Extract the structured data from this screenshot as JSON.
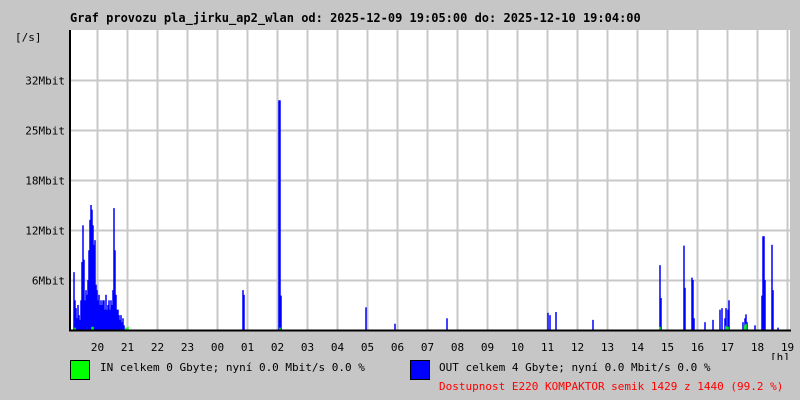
{
  "chart_data": {
    "type": "line",
    "title": "Graf provozu pla_jirku_ap2_wlan od: 2025-12-09 19:05:00 do: 2025-12-10 19:04:00",
    "ylabel": "[/s]",
    "xlabel": "[h]",
    "x_unit": "minutes since 2025-12-09 19:05",
    "xlim": [
      0,
      1440
    ],
    "ylim": [
      0,
      38.4
    ],
    "y_unit": "Mbit/s",
    "grid": true,
    "y_ticks": [
      {
        "value": 6.4,
        "label": "6Mbit"
      },
      {
        "value": 12.8,
        "label": "12Mbit"
      },
      {
        "value": 19.2,
        "label": "18Mbit"
      },
      {
        "value": 25.6,
        "label": "25Mbit"
      },
      {
        "value": 32.0,
        "label": "32Mbit"
      }
    ],
    "x_ticks": [
      "20",
      "21",
      "22",
      "23",
      "00",
      "01",
      "02",
      "03",
      "04",
      "05",
      "06",
      "07",
      "08",
      "09",
      "10",
      "11",
      "12",
      "13",
      "14",
      "15",
      "16",
      "17",
      "18",
      "19"
    ],
    "first_tick_minutes": 55,
    "series": [
      {
        "name": "IN",
        "color": "#00ff00",
        "points": [
          [
            10,
            0.3
          ],
          [
            44,
            0.4
          ],
          [
            46,
            0.4
          ],
          [
            112,
            0.3
          ],
          [
            116,
            0.4
          ],
          [
            420,
            0.3
          ],
          [
            1180,
            0.4
          ],
          [
            1312,
            0.5
          ],
          [
            1316,
            0.4
          ],
          [
            1350,
            0.6
          ],
          [
            1352,
            0.8
          ]
        ]
      },
      {
        "name": "OUT",
        "color": "#0000ff",
        "points": [
          [
            8,
            7.4
          ],
          [
            10,
            3.8
          ],
          [
            12,
            2.8
          ],
          [
            14,
            1.5
          ],
          [
            16,
            3.2
          ],
          [
            18,
            1.9
          ],
          [
            20,
            1.3
          ],
          [
            22,
            3.8
          ],
          [
            24,
            8.7
          ],
          [
            26,
            13.4
          ],
          [
            28,
            9.0
          ],
          [
            30,
            3.8
          ],
          [
            32,
            5.1
          ],
          [
            34,
            4.5
          ],
          [
            36,
            6.4
          ],
          [
            38,
            10.2
          ],
          [
            40,
            14.1
          ],
          [
            42,
            16.0
          ],
          [
            44,
            15.4
          ],
          [
            46,
            13.4
          ],
          [
            48,
            10.9
          ],
          [
            50,
            11.5
          ],
          [
            52,
            5.8
          ],
          [
            54,
            5.1
          ],
          [
            56,
            3.8
          ],
          [
            58,
            4.5
          ],
          [
            60,
            3.2
          ],
          [
            62,
            3.8
          ],
          [
            64,
            3.2
          ],
          [
            66,
            3.8
          ],
          [
            68,
            3.8
          ],
          [
            70,
            2.6
          ],
          [
            72,
            4.5
          ],
          [
            74,
            2.6
          ],
          [
            76,
            3.2
          ],
          [
            78,
            3.8
          ],
          [
            80,
            2.6
          ],
          [
            82,
            3.8
          ],
          [
            84,
            3.2
          ],
          [
            86,
            5.1
          ],
          [
            88,
            15.6
          ],
          [
            90,
            10.2
          ],
          [
            92,
            4.5
          ],
          [
            94,
            2.6
          ],
          [
            96,
            2.6
          ],
          [
            98,
            1.9
          ],
          [
            100,
            1.3
          ],
          [
            102,
            1.9
          ],
          [
            104,
            1.0
          ],
          [
            106,
            1.5
          ],
          [
            108,
            0.6
          ],
          [
            346,
            5.1
          ],
          [
            348,
            4.5
          ],
          [
            418,
            29.4
          ],
          [
            420,
            29.4
          ],
          [
            422,
            4.4
          ],
          [
            592,
            2.9
          ],
          [
            650,
            0.8
          ],
          [
            754,
            1.5
          ],
          [
            956,
            2.2
          ],
          [
            960,
            1.9
          ],
          [
            972,
            2.3
          ],
          [
            1046,
            1.3
          ],
          [
            1180,
            8.3
          ],
          [
            1182,
            4.1
          ],
          [
            1228,
            10.8
          ],
          [
            1230,
            5.4
          ],
          [
            1244,
            6.7
          ],
          [
            1246,
            6.4
          ],
          [
            1248,
            1.5
          ],
          [
            1270,
            1.0
          ],
          [
            1286,
            1.3
          ],
          [
            1300,
            2.6
          ],
          [
            1304,
            2.8
          ],
          [
            1310,
            1.5
          ],
          [
            1312,
            2.8
          ],
          [
            1316,
            2.6
          ],
          [
            1318,
            3.8
          ],
          [
            1346,
            1.0
          ],
          [
            1350,
            1.5
          ],
          [
            1352,
            2.0
          ],
          [
            1354,
            1.0
          ],
          [
            1370,
            0.6
          ],
          [
            1384,
            4.4
          ],
          [
            1386,
            12.0
          ],
          [
            1388,
            12.0
          ],
          [
            1390,
            6.4
          ],
          [
            1404,
            10.9
          ],
          [
            1406,
            5.1
          ],
          [
            1416,
            0.3
          ]
        ]
      }
    ]
  },
  "legend": {
    "in_text": "IN celkem 0 Gbyte; nyní   0.0 Mbit/s 0.0 %",
    "out_text": "OUT celkem 4 Gbyte; nyní   0.0 Mbit/s 0.0 %",
    "availability": "Dostupnost E220 KOMPAKTOR semik 1429 z 1440 (99.2 %)",
    "availability_color": "#ff0000"
  }
}
